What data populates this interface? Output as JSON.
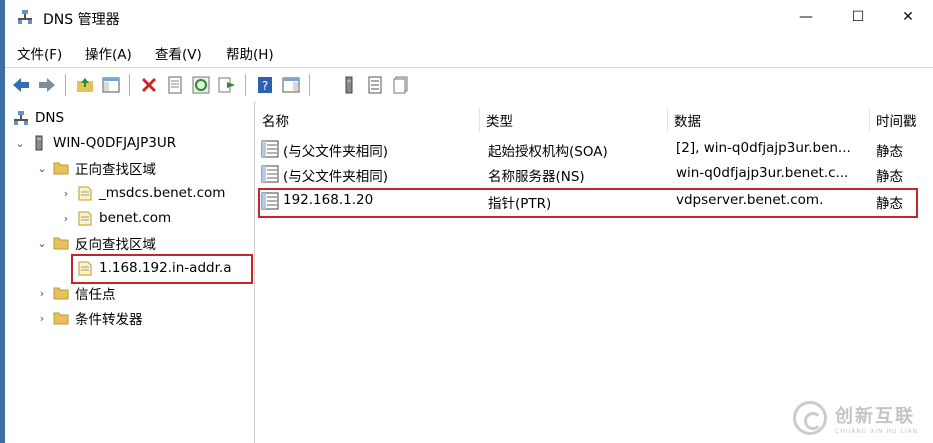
{
  "window": {
    "title": "DNS 管理器",
    "minimize": "—",
    "maximize": "☐",
    "close": "✕"
  },
  "menu": [
    "文件(F)",
    "操作(A)",
    "查看(V)",
    "帮助(H)"
  ],
  "tree": {
    "root": "DNS",
    "server": "WIN-Q0DFJAJP3UR",
    "forward_zones": "正向查找区域",
    "zone_msdcs": "_msdcs.benet.com",
    "zone_benet": "benet.com",
    "reverse_zones": "反向查找区域",
    "zone_reverse": "1.168.192.in-addr.a",
    "trust_points": "信任点",
    "conditional_forwarders": "条件转发器"
  },
  "list": {
    "columns": [
      "名称",
      "类型",
      "数据",
      "时间戳"
    ],
    "rows": [
      {
        "name": "(与父文件夹相同)",
        "type": "起始授权机构(SOA)",
        "data": "[2], win-q0dfjajp3ur.ben...",
        "ts": "静态"
      },
      {
        "name": "(与父文件夹相同)",
        "type": "名称服务器(NS)",
        "data": "win-q0dfjajp3ur.benet.c...",
        "ts": "静态"
      },
      {
        "name": "192.168.1.20",
        "type": "指针(PTR)",
        "data": "vdpserver.benet.com.",
        "ts": "静态"
      }
    ]
  },
  "watermark": {
    "cn": "创新互联",
    "en": "CHUANG XIN HU LIAN"
  },
  "colors": {
    "highlight": "#c0272d",
    "folder": "#e8c15a"
  }
}
